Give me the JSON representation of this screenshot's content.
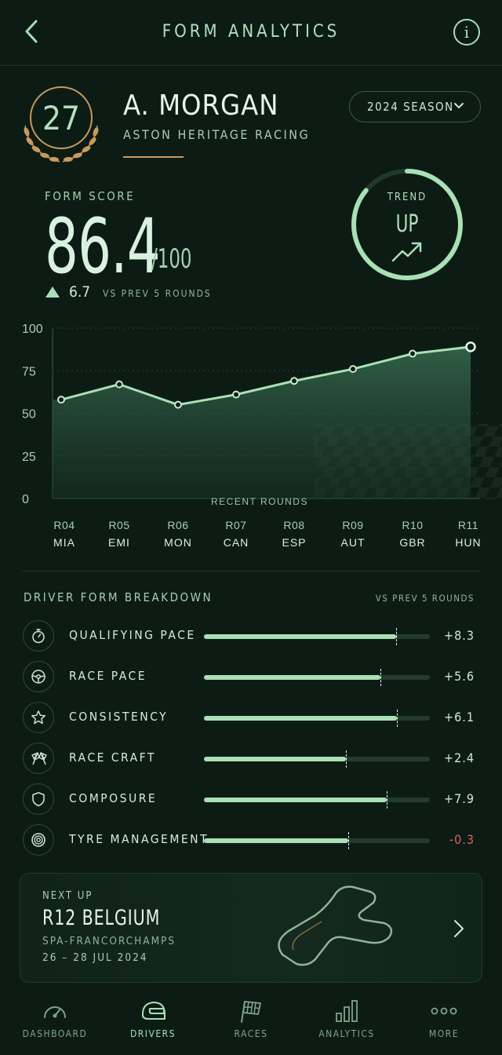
{
  "header": {
    "title": "FORM ANALYTICS",
    "back_icon": "chevron-left-icon",
    "info_icon": "info-icon",
    "info_glyph": "i"
  },
  "driver": {
    "number": "27",
    "name": "A. MORGAN",
    "team": "ASTON HERITAGE RACING",
    "season_label": "2024 SEASON"
  },
  "form_score": {
    "label": "FORM SCORE",
    "value": "86.4",
    "max": "/100",
    "delta": "6.7",
    "delta_label": "VS PREV 5 ROUNDS",
    "trend_label": "TREND",
    "trend_value": "UP",
    "trend_ring_fraction": 0.86
  },
  "chart_data": {
    "type": "area",
    "xlabel": "RECENT ROUNDS",
    "ylim": [
      0,
      100
    ],
    "yticks": [
      "100",
      "75",
      "50",
      "25",
      "0"
    ],
    "categories": [
      "R04",
      "R05",
      "R06",
      "R07",
      "R08",
      "R09",
      "R10",
      "R11"
    ],
    "category_sub": [
      "MIA",
      "EMI",
      "MON",
      "CAN",
      "ESP",
      "AUT",
      "GBR",
      "HUN"
    ],
    "values": [
      58,
      67,
      55,
      61,
      69,
      76,
      85,
      89
    ],
    "grid": true
  },
  "breakdown": {
    "title": "DRIVER FORM BREAKDOWN",
    "subtitle": "VS PREV 5 ROUNDS",
    "items": [
      {
        "label": "QUALIFYING PACE",
        "icon": "stopwatch-icon",
        "fill": 0.85,
        "marker": 0.85,
        "delta": "+8.3",
        "negative": false
      },
      {
        "label": "RACE PACE",
        "icon": "steering-wheel-icon",
        "fill": 0.78,
        "marker": 0.78,
        "delta": "+5.6",
        "negative": false
      },
      {
        "label": "CONSISTENCY",
        "icon": "star-icon",
        "fill": 0.855,
        "marker": 0.855,
        "delta": "+6.1",
        "negative": false
      },
      {
        "label": "RACE CRAFT",
        "icon": "checkered-flags-icon",
        "fill": 0.63,
        "marker": 0.63,
        "delta": "+2.4",
        "negative": false
      },
      {
        "label": "COMPOSURE",
        "icon": "shield-icon",
        "fill": 0.81,
        "marker": 0.81,
        "delta": "+7.9",
        "negative": false
      },
      {
        "label": "TYRE MANAGEMENT",
        "icon": "tyre-icon",
        "fill": 0.64,
        "marker": 0.64,
        "delta": "-0.3",
        "negative": true
      }
    ]
  },
  "next_up": {
    "label": "NEXT UP",
    "round": "R12",
    "country": "BELGIUM",
    "race": "R12  BELGIUM",
    "circuit": "SPA-FRANCORCHAMPS",
    "dates": "26 – 28 JUL 2024"
  },
  "nav": [
    {
      "label": "DASHBOARD",
      "icon": "gauge-icon",
      "active": false
    },
    {
      "label": "DRIVERS",
      "icon": "helmet-icon",
      "active": true
    },
    {
      "label": "RACES",
      "icon": "checkered-flag-icon",
      "active": false
    },
    {
      "label": "ANALYTICS",
      "icon": "bar-chart-icon",
      "active": false
    },
    {
      "label": "MORE",
      "icon": "more-dots-icon",
      "active": false
    }
  ],
  "colors": {
    "background": "#0c1c15",
    "accent": "#a9e0b5",
    "gold": "#c99a5b",
    "negative": "#e35d55"
  }
}
